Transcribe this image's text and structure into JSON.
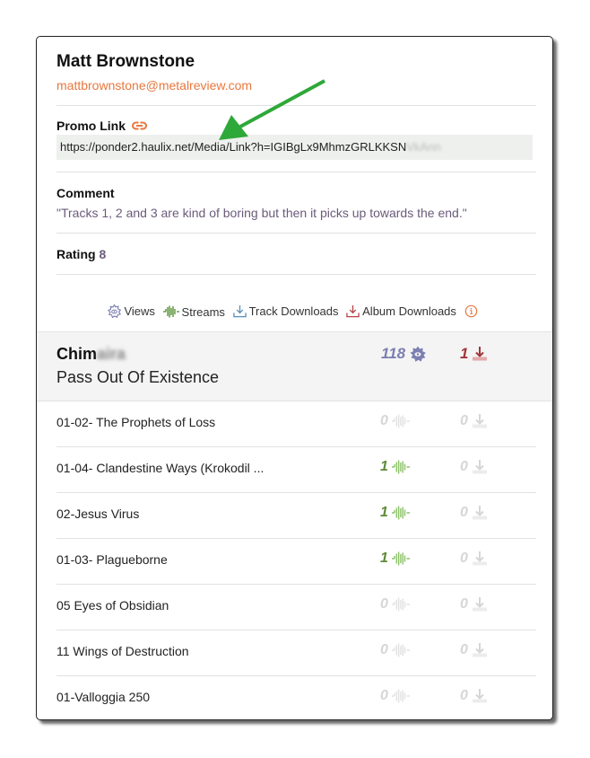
{
  "reviewer": {
    "name": "Matt Brownstone",
    "email": "mattbrownstone@metalreview.com"
  },
  "promo": {
    "label": "Promo Link",
    "icon": "link-icon",
    "url_visible": "https://ponder2.haulix.net/Media/Link?h=IGIBgLx9MhmzGRLKKSN",
    "url_blurred": "VkAnn"
  },
  "comment": {
    "label": "Comment",
    "text": "\"Tracks 1, 2 and 3 are kind of boring but then it picks up towards the end.\""
  },
  "rating": {
    "label": "Rating",
    "value": "8"
  },
  "legend": {
    "views": "Views",
    "streams": "Streams",
    "track_downloads": "Track Downloads",
    "album_downloads": "Album Downloads",
    "info_icon": "info-icon"
  },
  "album": {
    "artist_visible": "Chim",
    "artist_blurred": "aira",
    "title": "Pass Out Of Existence",
    "views": "118",
    "album_downloads": "1"
  },
  "tracks": [
    {
      "title": "01-02- The Prophets of Loss",
      "streams": "0",
      "downloads": "0"
    },
    {
      "title": "01-04- Clandestine Ways (Krokodil ...",
      "streams": "1",
      "downloads": "0"
    },
    {
      "title": "02-Jesus Virus",
      "streams": "1",
      "downloads": "0"
    },
    {
      "title": "01-03- Plagueborne",
      "streams": "1",
      "downloads": "0"
    },
    {
      "title": "05 Eyes of Obsidian",
      "streams": "0",
      "downloads": "0"
    },
    {
      "title": "11 Wings of Destruction",
      "streams": "0",
      "downloads": "0"
    },
    {
      "title": "01-Valloggia 250",
      "streams": "0",
      "downloads": "0"
    }
  ],
  "colors": {
    "email": "#e8773e",
    "views": "#7c7fb0",
    "album_download": "#a0373c",
    "streams_active": "#5f8a37",
    "inactive": "#d6d6d6",
    "annotation_arrow": "#2fa83a"
  }
}
